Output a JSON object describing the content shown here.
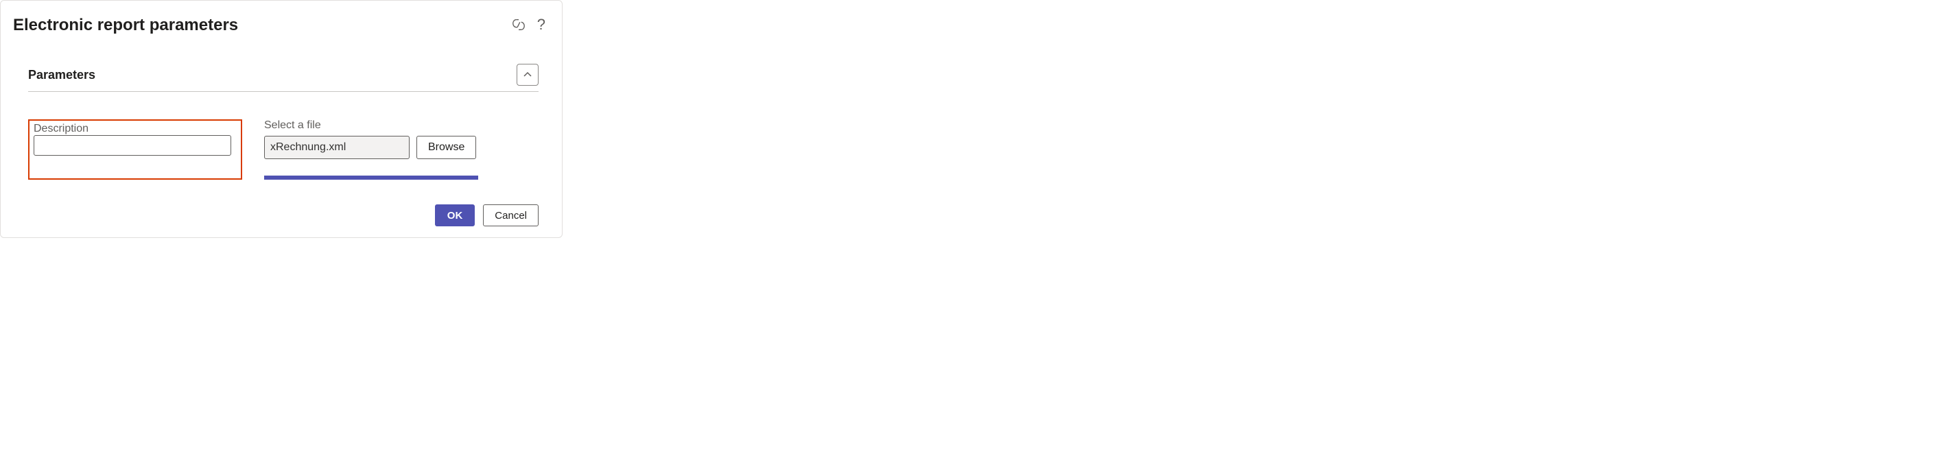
{
  "dialog": {
    "title": "Electronic report parameters"
  },
  "section": {
    "title": "Parameters"
  },
  "fields": {
    "description": {
      "label": "Description",
      "value": ""
    },
    "file": {
      "label": "Select a file",
      "value": "xRechnung.xml",
      "browse_label": "Browse"
    }
  },
  "footer": {
    "ok_label": "OK",
    "cancel_label": "Cancel"
  }
}
